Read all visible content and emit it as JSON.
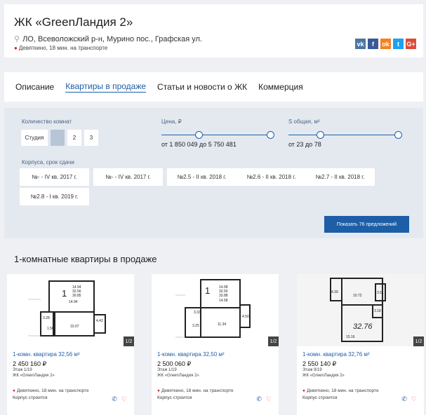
{
  "header": {
    "title": "ЖК «GreenЛандия 2»",
    "address": "ЛО, Всеволожский р-н, Мурино пос., Графская ул.",
    "metro": "Девяткино, 18 мин. на транспорте",
    "social": [
      {
        "icon": "vk-icon",
        "label": "vk",
        "color": "#4c75a3"
      },
      {
        "icon": "facebook-icon",
        "label": "f",
        "color": "#3b5998"
      },
      {
        "icon": "odnoklassniki-icon",
        "label": "ok",
        "color": "#f58220"
      },
      {
        "icon": "twitter-icon",
        "label": "t",
        "color": "#1da1f2"
      },
      {
        "icon": "google-plus-icon",
        "label": "G+",
        "color": "#dd4b39"
      }
    ]
  },
  "tabs": [
    "Описание",
    "Квартиры в продаже",
    "Статьи и новости о ЖК",
    "Коммерция"
  ],
  "filters": {
    "rooms_label": "Количество комнат",
    "rooms": [
      "Студия",
      "1",
      "2",
      "3"
    ],
    "price_label": "Цена, ₽",
    "price_range": "от 1 850 049 до 5 750 481",
    "area_label": "S общая, м²",
    "area_range": "от 23 до 78",
    "buildings_label": "Корпуса, срок сдачи",
    "buildings": [
      "№- - IV кв. 2017 г.",
      "№- - IV кв. 2017 г.",
      "№2.5 - II кв. 2018 г.",
      "№2.6 - II кв. 2018 г.",
      "№2.7 - II кв. 2018 г.",
      "№2.8 - I кв. 2019 г."
    ],
    "show_button": "Показать 76 предложений"
  },
  "section_title": "1-комнатные квартиры в продаже",
  "cards": [
    {
      "title": "1-комн. квартира 32,56 м²",
      "price": "2 450 160 ₽",
      "floor": "Этаж 1/19",
      "complex": "ЖК «GreenЛандия 2»",
      "metro": "Девяткино, 18 мин. на транспорте",
      "status": "Корпус строится",
      "badge": "1/2",
      "plan_labels": [
        "1",
        "14.94",
        "32.56",
        "30.85",
        "14.94",
        "3.28",
        "1.56",
        "10.07",
        "4.42"
      ]
    },
    {
      "title": "1-комн. квартира 32,50 м²",
      "price": "2 500 060 ₽",
      "floor": "Этаж 1/19",
      "complex": "ЖК «GreenЛандия 2»",
      "metro": "Девяткино, 18 мин. на транспорте",
      "status": "Корпус строится",
      "badge": "1/2",
      "plan_labels": [
        "1",
        "14.58",
        "32.50",
        "33.88",
        "14.58",
        "3.33",
        "3.25",
        "11.34",
        "4.50"
      ]
    },
    {
      "title": "1-комн. квартира 32,76 м²",
      "price": "2 550 140 ₽",
      "floor": "Этаж 9/19",
      "complex": "ЖК «GreenЛандия 2»",
      "metro": "Девяткино, 18 мин. на транспорте",
      "status": "Корпус строится",
      "badge": "1/2",
      "plan_labels": [
        "4.39",
        "10.72",
        "3.51",
        "3.18",
        "32.76",
        "15.16"
      ]
    }
  ]
}
